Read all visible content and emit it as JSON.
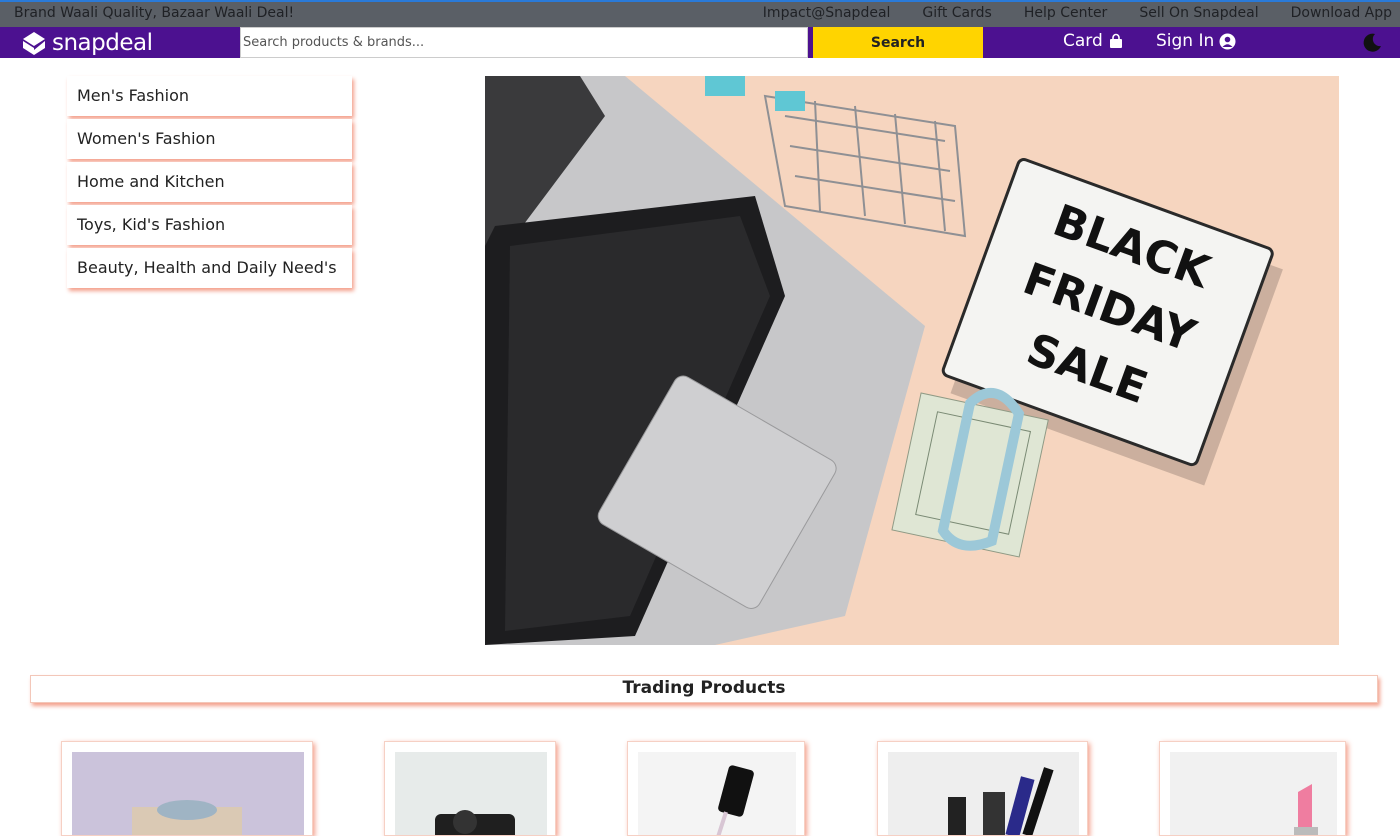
{
  "topbar": {
    "tagline": "Brand Waali Quality, Bazaar Waali Deal!",
    "links": [
      "Impact@Snapdeal",
      "Gift Cards",
      "Help Center",
      "Sell On Snapdeal",
      "Download App"
    ]
  },
  "navbar": {
    "logo_text": "snapdeal",
    "search_placeholder": "Search products & brands...",
    "search_button": "Search",
    "cart_label": "Card",
    "signin_label": "Sign In"
  },
  "categories": [
    "Men's Fashion",
    "Women's Fashion",
    "Home and Kitchen",
    "Toys, Kid's Fashion",
    "Beauty, Health and Daily Need's"
  ],
  "hero": {
    "sign_lines": [
      "BLACK",
      "FRIDAY",
      "SALE"
    ]
  },
  "trending": {
    "title": "Trading Products"
  },
  "colors": {
    "brand_purple": "#4c1190",
    "search_yellow": "#ffd400",
    "topbar_gray": "#5a5f66",
    "shadow_salmon": "#f4a08c"
  },
  "icons": [
    "logo-mark-icon",
    "shopping-bag-icon",
    "user-circle-icon",
    "moon-icon"
  ]
}
